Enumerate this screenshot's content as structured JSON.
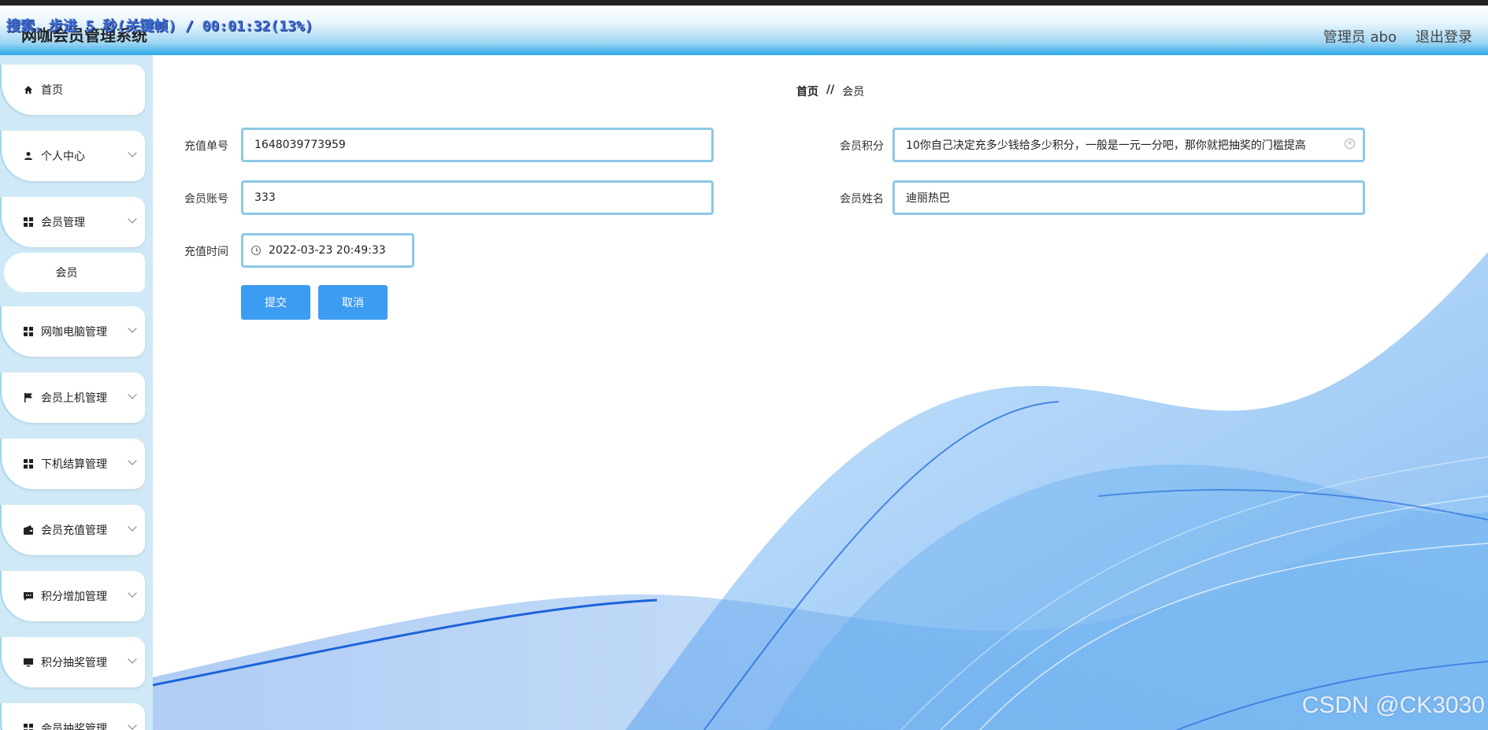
{
  "header": {
    "app_title": "网咖会员管理系统",
    "recording_overlay": "搜索，步进 5 秒(关键帧) / 00:01:32(13%)",
    "admin_label": "管理员 abo",
    "logout_label": "退出登录"
  },
  "sidebar": {
    "items": [
      {
        "label": "首页",
        "icon": "home-icon",
        "has_chevron": false
      },
      {
        "label": "个人中心",
        "icon": "user-icon",
        "has_chevron": true
      },
      {
        "label": "会员管理",
        "icon": "grid-icon",
        "has_chevron": true
      },
      {
        "label": "网咖电脑管理",
        "icon": "grid-icon",
        "has_chevron": true
      },
      {
        "label": "会员上机管理",
        "icon": "flag-icon",
        "has_chevron": true
      },
      {
        "label": "下机结算管理",
        "icon": "grid-icon",
        "has_chevron": true
      },
      {
        "label": "会员充值管理",
        "icon": "wallet-icon",
        "has_chevron": true
      },
      {
        "label": "积分增加管理",
        "icon": "message-icon",
        "has_chevron": true
      },
      {
        "label": "积分抽奖管理",
        "icon": "monitor-icon",
        "has_chevron": true
      },
      {
        "label": "会员抽奖管理",
        "icon": "grid-icon",
        "has_chevron": true
      }
    ],
    "sub_item": "会员"
  },
  "breadcrumb": {
    "home": "首页",
    "separator": "//",
    "current": "会员"
  },
  "form": {
    "order_no_label": "充值单号",
    "order_no_value": "1648039773959",
    "account_label": "会员账号",
    "account_value": "333",
    "time_label": "充值时间",
    "time_value": "2022-03-23 20:49:33",
    "points_label": "会员积分",
    "points_value": "10你自己决定充多少钱给多少积分，一般是一元一分吧，那你就把抽奖的门槛提高",
    "name_label": "会员姓名",
    "name_value": "迪丽热巴",
    "submit_label": "提交",
    "cancel_label": "取消"
  },
  "watermark": "CSDN @CK3030",
  "colors": {
    "primary_button": "#3c9cf1",
    "input_border": "#8cc8e6",
    "sidebar_bg": "#cfe9f7",
    "header_gradient_end": "#2aa7e8"
  }
}
